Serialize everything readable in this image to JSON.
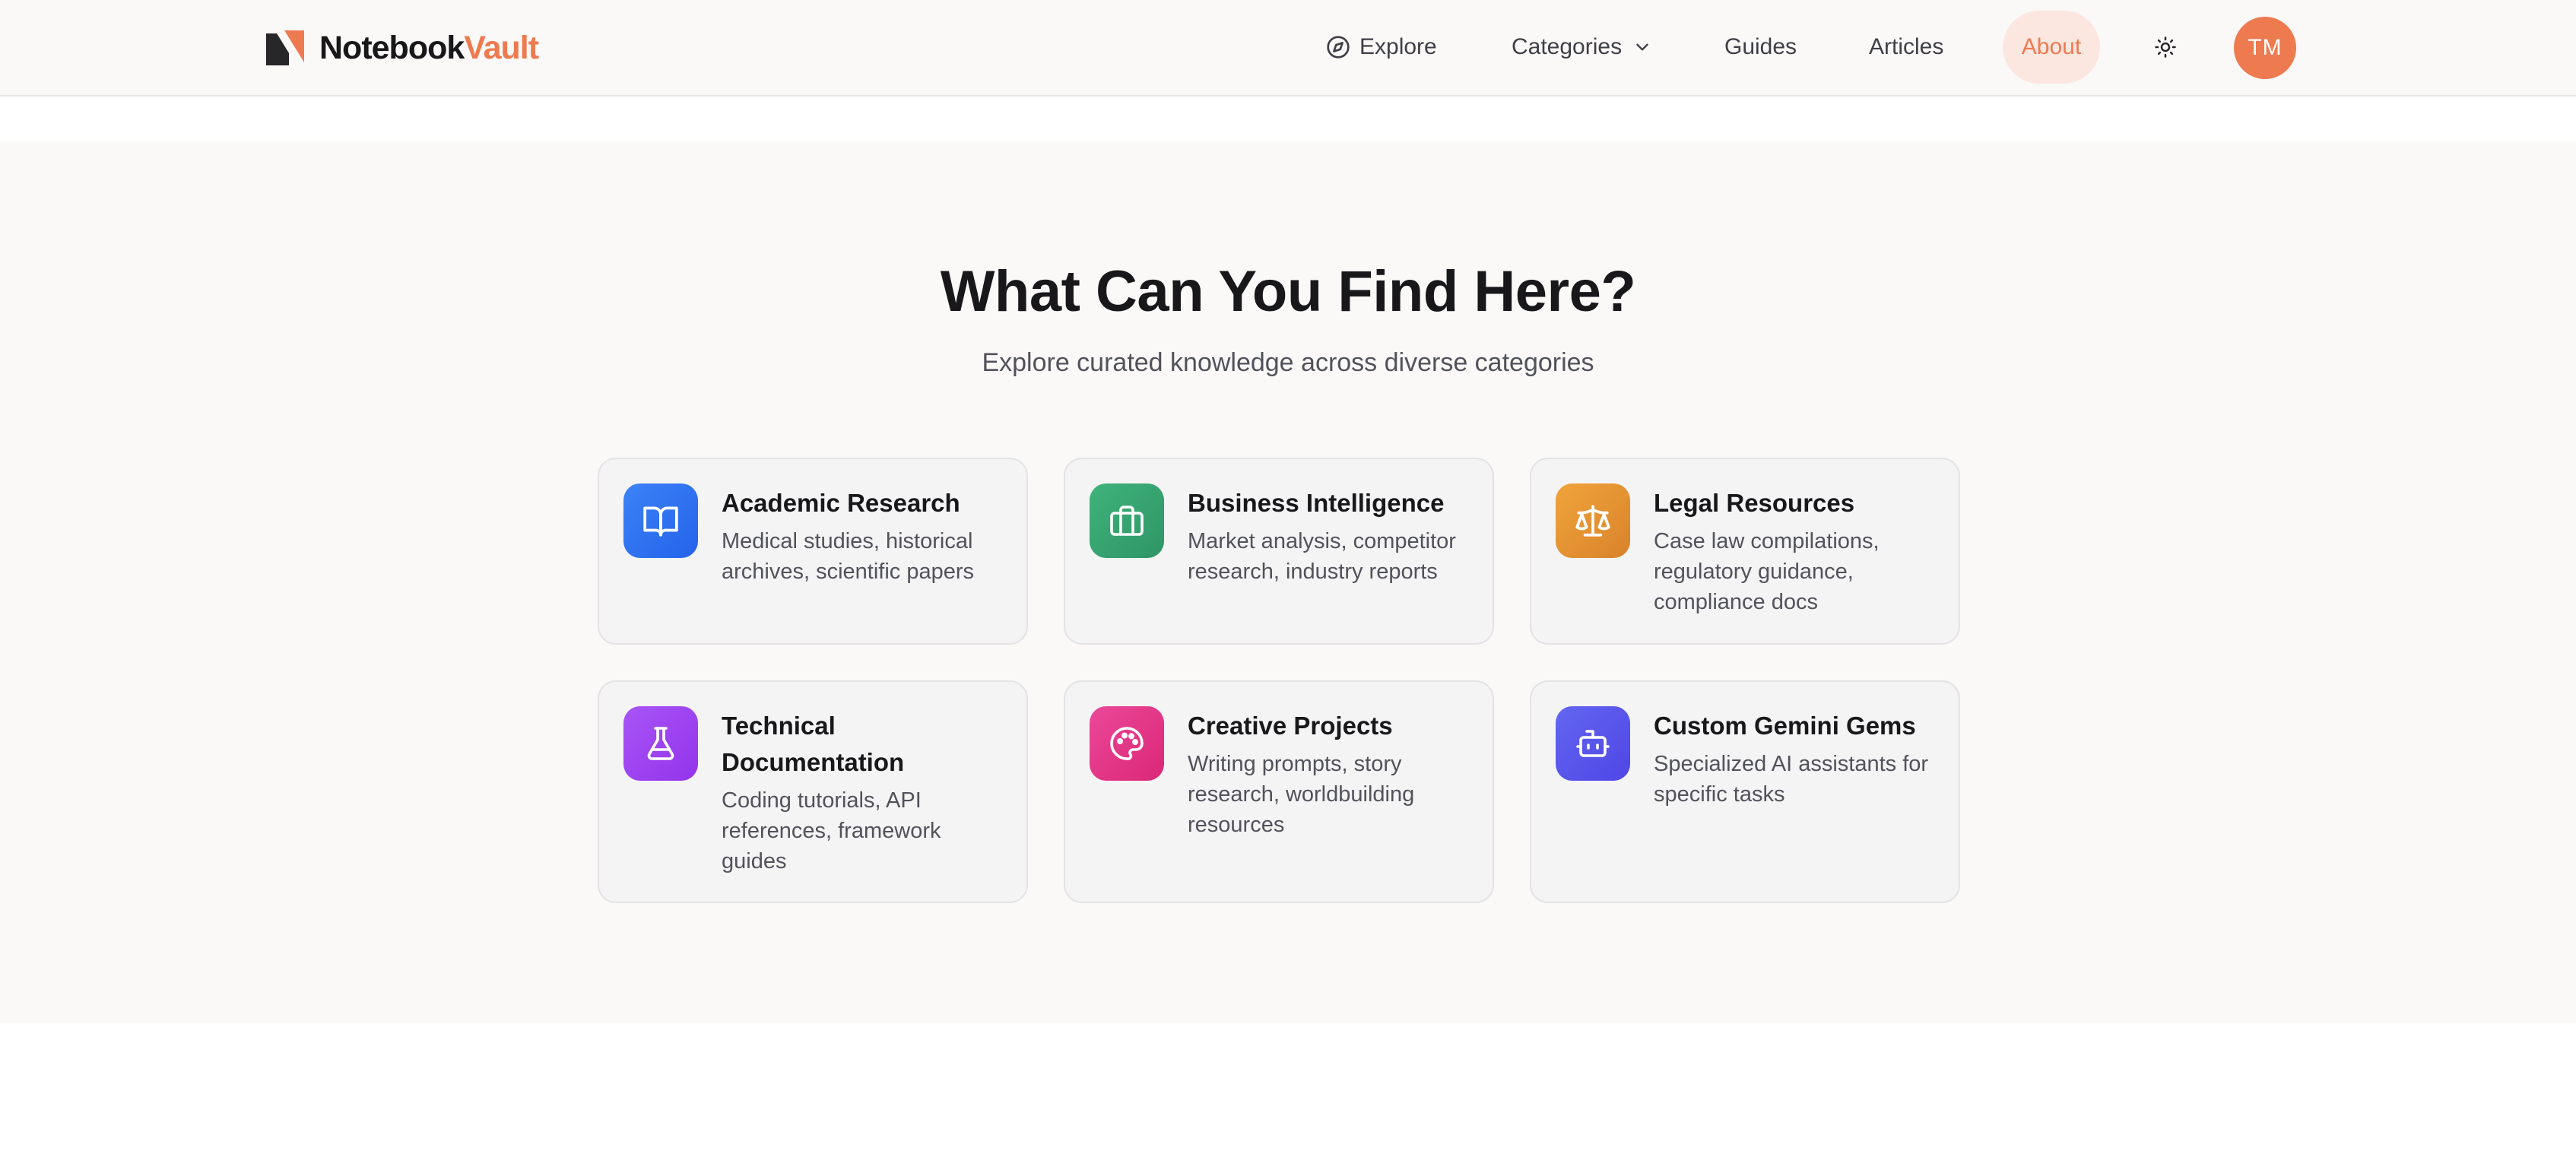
{
  "header": {
    "brand": {
      "part1": "Notebook",
      "part2": "Vault",
      "accent_color": "#ee7a50"
    },
    "nav": {
      "explore": "Explore",
      "categories": "Categories",
      "guides": "Guides",
      "articles": "Articles",
      "about": "About"
    },
    "icons": {
      "explore": "compass-icon",
      "categories": "chevron-down-icon",
      "theme": "sun-icon"
    },
    "avatar_initials": "TM"
  },
  "section": {
    "title": "What Can You Find Here?",
    "subtitle": "Explore curated knowledge across diverse categories",
    "cards": [
      {
        "title": "Academic Research",
        "description": "Medical studies, historical archives, scientific papers",
        "icon": "book-open-icon",
        "color": "#3b82f6"
      },
      {
        "title": "Business Intelligence",
        "description": "Market analysis, competitor research, industry reports",
        "icon": "briefcase-icon",
        "color": "#3fb37a"
      },
      {
        "title": "Legal Resources",
        "description": "Case law compilations, regulatory guidance, compliance docs",
        "icon": "scale-icon",
        "color": "#e8953a"
      },
      {
        "title": "Technical Documentation",
        "description": "Coding tutorials, API references, framework guides",
        "icon": "flask-icon",
        "color": "#a855f7"
      },
      {
        "title": "Creative Projects",
        "description": "Writing prompts, story research, worldbuilding resources",
        "icon": "palette-icon",
        "color": "#ec4899"
      },
      {
        "title": "Custom Gemini Gems",
        "description": "Specialized AI assistants for specific tasks",
        "icon": "bot-icon",
        "color": "#6366f1"
      }
    ]
  }
}
